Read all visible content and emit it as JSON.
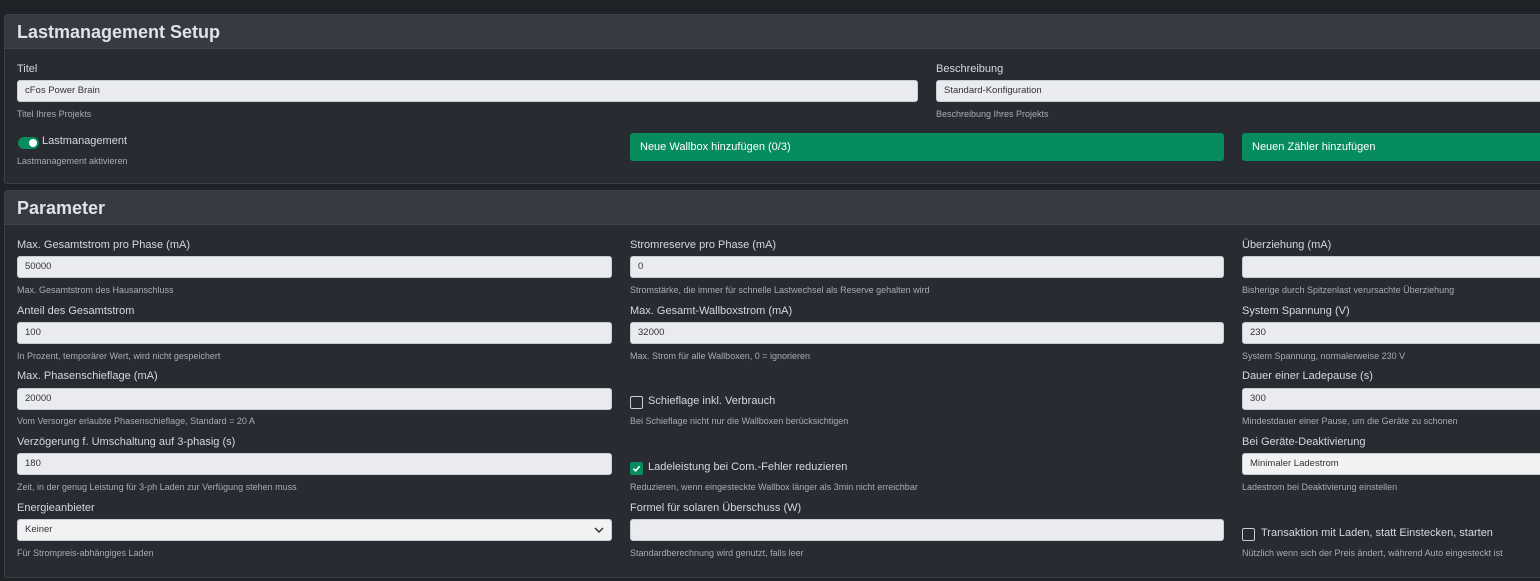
{
  "setup": {
    "title": "Lastmanagement Setup",
    "titel_label": "Titel",
    "titel_value": "cFos Power Brain",
    "titel_help": "Titel Ihres Projekts",
    "beschreibung_label": "Beschreibung",
    "beschreibung_value": "Standard-Konfiguration",
    "beschreibung_help": "Beschreibung Ihres Projekts",
    "lastmanagement_label": "Lastmanagement",
    "lastmanagement_help": "Lastmanagement aktivieren",
    "lastmanagement_on": true,
    "add_wallbox_label": "Neue Wallbox hinzufügen (0/3)",
    "add_meter_label": "Neuen Zähler hinzufügen"
  },
  "params": {
    "title": "Parameter",
    "max_gesamtstrom": {
      "label": "Max. Gesamtstrom pro Phase (mA)",
      "value": "50000",
      "help": "Max. Gesamtstrom des Hausanschluss"
    },
    "stromreserve": {
      "label": "Stromreserve pro Phase (mA)",
      "value": "0",
      "help": "Stromstärke, die immer für schnelle Lastwechsel als Reserve gehalten wird"
    },
    "ueberziehung": {
      "label": "Überziehung (mA)",
      "value": "",
      "help": "Bisherige durch Spitzenlast verursachte Überziehung"
    },
    "anteil": {
      "label": "Anteil des Gesamtstrom",
      "value": "100",
      "help": "In Prozent, temporärer Wert, wird nicht gespeichert"
    },
    "max_wallboxstrom": {
      "label": "Max. Gesamt-Wallboxstrom (mA)",
      "value": "32000",
      "help": "Max. Strom für alle Wallboxen, 0 = ignorieren"
    },
    "system_spannung": {
      "label": "System Spannung (V)",
      "value": "230",
      "help": "System Spannung, normalerweise 230 V"
    },
    "phasenschieflage": {
      "label": "Max. Phasenschieflage (mA)",
      "value": "20000",
      "help": "Vom Versorger erlaubte Phasenschieflage, Standard = 20 A"
    },
    "schieflage_verbrauch": {
      "label": "Schieflage inkl. Verbrauch",
      "checked": false,
      "help": "Bei Schieflage nicht nur die Wallboxen berücksichtigen"
    },
    "ladepause": {
      "label": "Dauer einer Ladepause (s)",
      "value": "300",
      "help": "Mindestdauer einer Pause, um die Geräte zu schonen"
    },
    "verzoegerung": {
      "label": "Verzögerung f. Umschaltung auf 3-phasig (s)",
      "value": "180",
      "help": "Zeit, in der genug Leistung für 3-ph Laden zur Verfügung stehen muss"
    },
    "com_fehler": {
      "label": "Ladeleistung bei Com.-Fehler reduzieren",
      "checked": true,
      "help": "Reduzieren, wenn eingesteckte Wallbox länger als 3min nicht erreichbar"
    },
    "deaktivierung": {
      "label": "Bei Geräte-Deaktivierung",
      "value": "Minimaler Ladestrom",
      "help": "Ladestrom bei Deaktivierung einstellen"
    },
    "energieanbieter": {
      "label": "Energieanbieter",
      "value": "Keiner",
      "help": "Für Strompreis-abhängiges Laden"
    },
    "formel": {
      "label": "Formel für solaren Überschuss (W)",
      "value": "",
      "help": "Standardberechnung wird genutzt, falls leer"
    },
    "transaktion": {
      "label": "Transaktion mit Laden, statt Einstecken, starten",
      "checked": false,
      "help": "Nützlich wenn sich der Preis ändert, während Auto eingesteckt ist"
    }
  },
  "colors": {
    "accent": "#078c5e",
    "panel": "#282b31",
    "header": "#373a43",
    "background": "#1f2227"
  }
}
